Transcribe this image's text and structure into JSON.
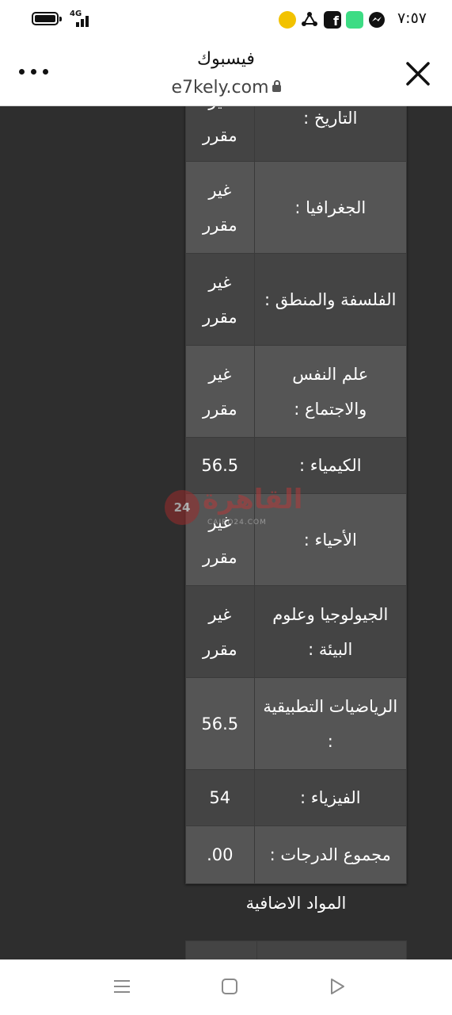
{
  "status_bar": {
    "time": "٧:٥٧",
    "network": "4G",
    "icons": [
      "smiley-app-icon",
      "sync-icon",
      "facebook-icon",
      "android-update-icon",
      "messenger-icon"
    ]
  },
  "browser": {
    "title": "فيسبوك",
    "url": "e7kely.com"
  },
  "grades_table": {
    "rows": [
      {
        "subject": "التاريخ :",
        "value": "غير مقرر"
      },
      {
        "subject": "الجغرافيا :",
        "value": "غير مقرر"
      },
      {
        "subject": "الفلسفة والمنطق :",
        "value": "غير مقرر"
      },
      {
        "subject": "علم النفس والاجتماع :",
        "value": "غير مقرر"
      },
      {
        "subject": "الكيمياء :",
        "value": "56.5"
      },
      {
        "subject": "الأحياء :",
        "value": "غير مقرر"
      },
      {
        "subject": "الجيولوجيا وعلوم البيئة :",
        "value": "غير مقرر"
      },
      {
        "subject": "الرياضيات التطبيقية :",
        "value": "56.5"
      },
      {
        "subject": "الفيزياء :",
        "value": "54"
      },
      {
        "subject": "مجموع الدرجات :",
        "value": "00."
      }
    ]
  },
  "extra_section": {
    "title": "المواد الاضافية"
  },
  "watermark": {
    "text": "القاهرة",
    "badge": "24",
    "sub": "CAIRO24.COM"
  },
  "colors": {
    "page_bg": "#2e2e2e",
    "row_dark": "#444444",
    "row_light": "#555555"
  }
}
